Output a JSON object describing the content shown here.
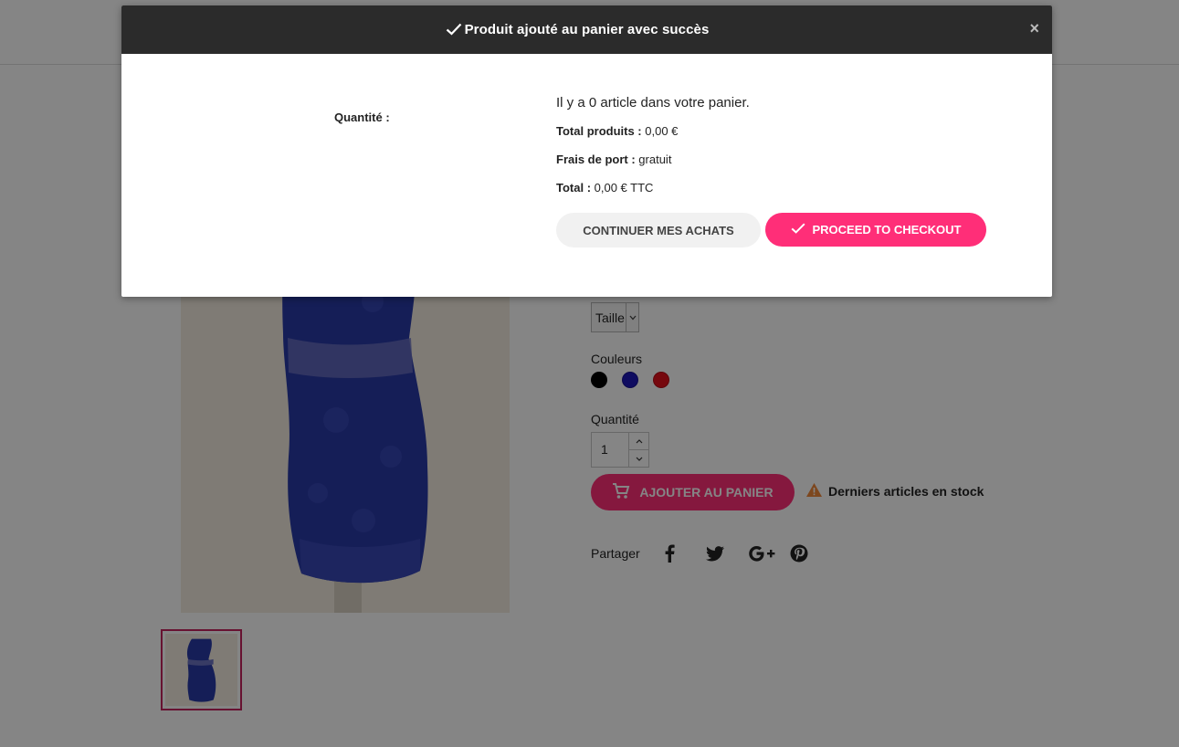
{
  "product": {
    "size_select_value": "Taille",
    "colors_label": "Couleurs",
    "colors": [
      "#000000",
      "#1d17b8",
      "#e3101c"
    ],
    "quantity_label": "Quantité",
    "quantity_value": "1",
    "add_to_cart_label": "AJOUTER AU PANIER",
    "stock_alert": "Derniers articles en stock",
    "share_label": "Partager",
    "share_icons": [
      "facebook-icon",
      "twitter-icon",
      "google-plus-icon",
      "pinterest-icon"
    ]
  },
  "modal": {
    "title": "Produit ajouté au panier avec succès",
    "close_symbol": "×",
    "quantity_label": "Quantité :",
    "cart_count_text": "Il y a 0 article dans votre panier.",
    "total_products_label": "Total produits :",
    "total_products_value": " 0,00 €",
    "shipping_label": "Frais de port :",
    "shipping_value": " gratuit",
    "total_label": "Total :",
    "total_value": " 0,00 € TTC",
    "continue_label": "CONTINUER MES ACHATS",
    "checkout_label": "PROCEED TO CHECKOUT"
  },
  "colors": {
    "accent": "#ff2e78",
    "thumb_border": "#c5245e",
    "header_bg": "#2b2b2b",
    "stock_warning": "#f0883a"
  }
}
